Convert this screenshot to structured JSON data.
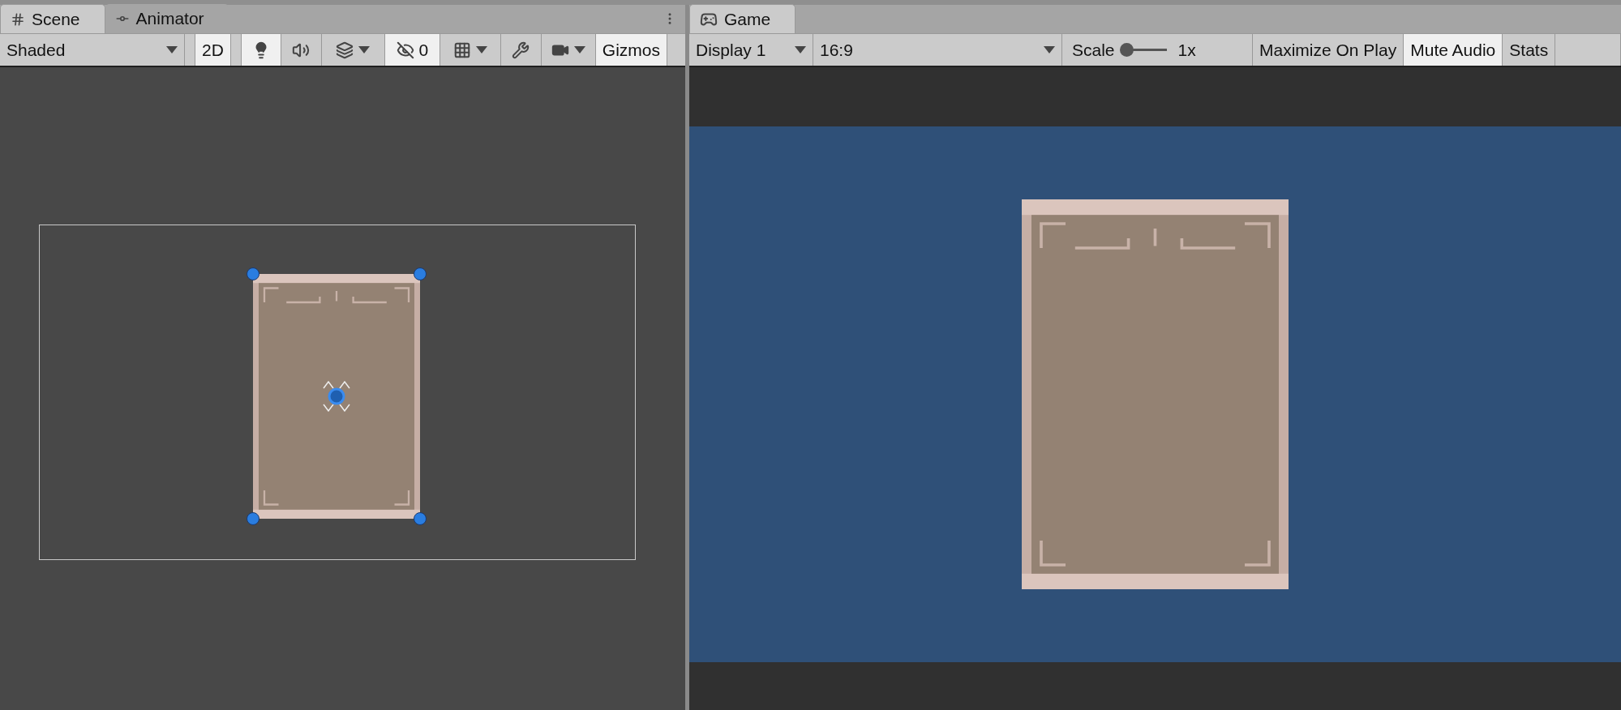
{
  "scene_view": {
    "tabs": [
      {
        "label": "Scene",
        "kind": "scene",
        "selected": true
      },
      {
        "label": "Animator",
        "kind": "animator",
        "selected": false
      }
    ],
    "toolbar": [
      {
        "kind": "dropdown",
        "label": "Shaded"
      },
      {
        "kind": "text",
        "label": "2D",
        "on": true
      },
      {
        "kind": "lighting",
        "on": true
      },
      {
        "kind": "audio",
        "on": false
      },
      {
        "kind": "effects",
        "on": false
      },
      {
        "kind": "visibility",
        "label": "0",
        "on": true
      },
      {
        "kind": "grid",
        "on": false
      },
      {
        "kind": "tools",
        "on": false
      },
      {
        "kind": "camera",
        "on": false
      },
      {
        "kind": "text",
        "label": "Gizmos",
        "on": true
      }
    ]
  },
  "game_view": {
    "tabs": [
      {
        "label": "Game",
        "kind": "game",
        "selected": true
      }
    ],
    "toolbar": [
      {
        "kind": "dropdown",
        "label": "Display 1"
      },
      {
        "kind": "wide-dropdown",
        "label": "16:9"
      },
      {
        "kind": "slider",
        "label": "Scale",
        "reading": "1x",
        "level": 0
      },
      {
        "kind": "text",
        "label": "Maximize On Play",
        "on": false
      },
      {
        "kind": "text",
        "label": "Mute Audio",
        "on": true
      },
      {
        "kind": "text",
        "label": "Stats",
        "on": false
      }
    ]
  }
}
